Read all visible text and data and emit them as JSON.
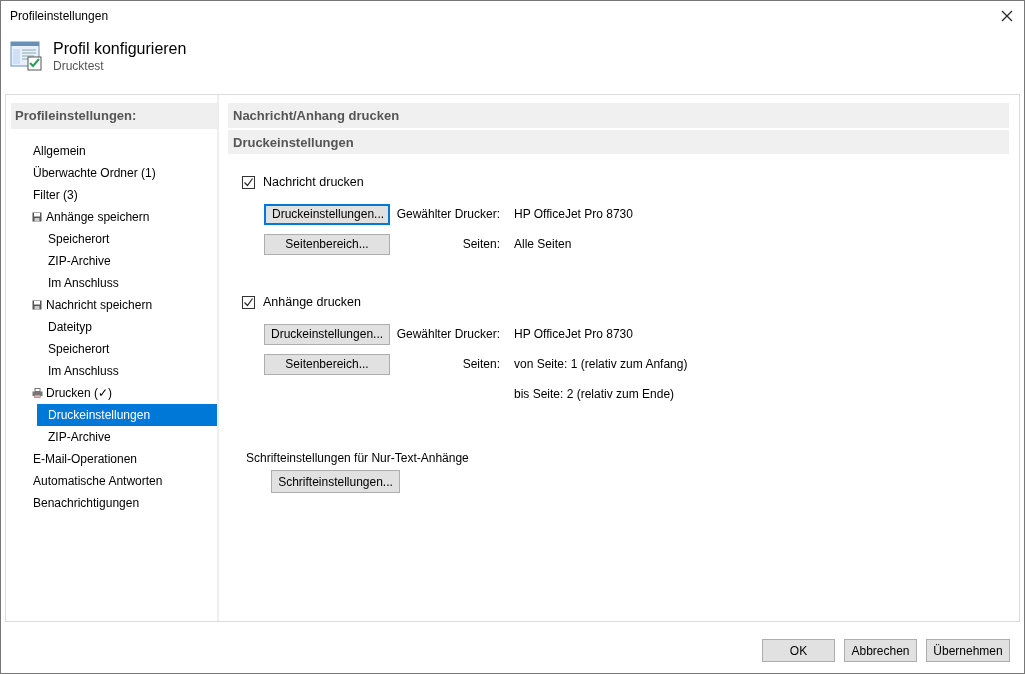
{
  "window": {
    "title": "Profileinstellungen"
  },
  "header": {
    "title": "Profil konfigurieren",
    "subtitle": "Drucktest"
  },
  "sidebar": {
    "heading": "Profileinstellungen:",
    "items": [
      {
        "label": "Allgemein",
        "selected": false
      },
      {
        "label": "Überwachte Ordner (1)",
        "selected": false
      },
      {
        "label": "Filter (3)",
        "selected": false
      },
      {
        "label": "Anhänge speichern",
        "kind": "save",
        "selected": false,
        "children": [
          {
            "label": "Speicherort",
            "selected": false
          },
          {
            "label": "ZIP-Archive",
            "selected": false
          },
          {
            "label": "Im Anschluss",
            "selected": false
          }
        ]
      },
      {
        "label": "Nachricht speichern",
        "kind": "save",
        "selected": false,
        "children": [
          {
            "label": "Dateityp",
            "selected": false
          },
          {
            "label": "Speicherort",
            "selected": false
          },
          {
            "label": "Im Anschluss",
            "selected": false
          }
        ]
      },
      {
        "label": "Drucken (✓)",
        "kind": "print",
        "selected": false,
        "children": [
          {
            "label": "Druckeinstellungen",
            "selected": true
          },
          {
            "label": "ZIP-Archive",
            "selected": false
          }
        ]
      },
      {
        "label": "E-Mail-Operationen",
        "selected": false
      },
      {
        "label": "Automatische Antworten",
        "selected": false
      },
      {
        "label": "Benachrichtigungen",
        "selected": false
      }
    ]
  },
  "content": {
    "title": "Nachricht/Anhang drucken",
    "subtitle": "Druckeinstellungen",
    "groups": [
      {
        "label": "Nachricht drucken",
        "checked": true,
        "rows": [
          {
            "button": "Druckeinstellungen...",
            "focused": true,
            "label": "Gewählter Drucker:",
            "value": "HP OfficeJet Pro 8730"
          },
          {
            "button": "Seitenbereich...",
            "focused": false,
            "label": "Seiten:",
            "value": "Alle Seiten"
          }
        ]
      },
      {
        "label": "Anhänge drucken",
        "checked": true,
        "rows": [
          {
            "button": "Druckeinstellungen...",
            "focused": false,
            "label": "Gewählter Drucker:",
            "value": "HP OfficeJet Pro 8730"
          },
          {
            "button": "Seitenbereich...",
            "focused": false,
            "label": "Seiten:",
            "value": "von Seite: 1 (relativ zum Anfang)"
          },
          {
            "value": "bis Seite: 2 (relativ zum Ende)"
          }
        ]
      }
    ],
    "font": {
      "label": "Schrifteinstellungen für Nur-Text-Anhänge",
      "button": "Schrifteinstellungen..."
    }
  },
  "buttons": [
    "OK",
    "Abbrechen",
    "Übernehmen"
  ]
}
